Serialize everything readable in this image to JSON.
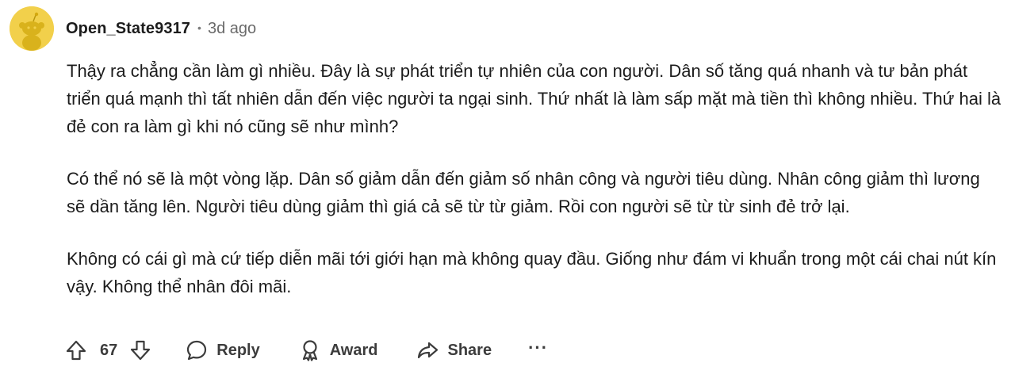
{
  "comment": {
    "author": "Open_State9317",
    "separator": "•",
    "timestamp": "3d ago",
    "avatar_icon": "snoo-avatar-icon",
    "avatar_color": "#f2d04b",
    "paragraphs": [
      "Thậy ra chẳng cần làm gì nhiều. Đây là sự phát triển tự nhiên của con người. Dân số tăng quá nhanh và tư bản phát triển quá mạnh thì tất nhiên dẫn đến việc người ta ngại sinh. Thứ nhất là làm sấp mặt mà tiền thì không nhiều. Thứ hai là đẻ con ra làm gì khi nó cũng sẽ như mình?",
      "Có thể nó sẽ là một vòng lặp. Dân số giảm dẫn đến giảm số nhân công và người tiêu dùng. Nhân công giảm thì lương sẽ dần tăng lên. Người tiêu dùng giảm thì giá cả sẽ từ từ giảm. Rồi con người sẽ từ từ sinh đẻ trở lại.",
      "Không có cái gì mà cứ tiếp diễn mãi tới giới hạn mà không quay đầu. Giống như đám vi khuẩn trong một cái chai nút kín vậy. Không thể nhân đôi mãi."
    ]
  },
  "actions": {
    "upvote_icon": "upvote-arrow-icon",
    "score": "67",
    "downvote_icon": "downvote-arrow-icon",
    "reply_icon": "chat-bubble-icon",
    "reply_label": "Reply",
    "award_icon": "award-ribbon-icon",
    "award_label": "Award",
    "share_icon": "share-arrow-icon",
    "share_label": "Share",
    "more_label": "···"
  }
}
